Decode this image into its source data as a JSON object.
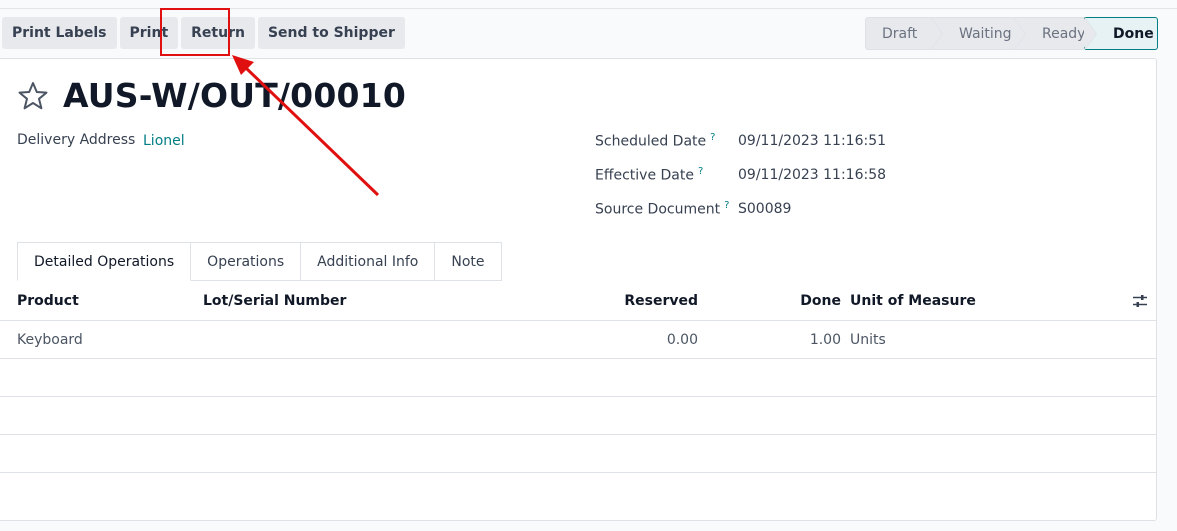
{
  "toolbar": {
    "print_labels": "Print Labels",
    "print": "Print",
    "return": "Return",
    "send_to_shipper": "Send to Shipper"
  },
  "statusbar": {
    "stages": [
      "Draft",
      "Waiting",
      "Ready",
      "Done"
    ],
    "active_stage": "Done"
  },
  "record": {
    "title": "AUS-W/OUT/00010",
    "delivery_address_label": "Delivery Address",
    "delivery_address_value": "Lionel",
    "scheduled_date_label": "Scheduled Date",
    "scheduled_date_value": "09/11/2023 11:16:51",
    "effective_date_label": "Effective Date",
    "effective_date_value": "09/11/2023 11:16:58",
    "source_document_label": "Source Document",
    "source_document_value": "S00089",
    "help_mark": "?"
  },
  "tabs": [
    "Detailed Operations",
    "Operations",
    "Additional Info",
    "Note"
  ],
  "table": {
    "columns": {
      "product": "Product",
      "lot": "Lot/Serial Number",
      "reserved": "Reserved",
      "done": "Done",
      "uom": "Unit of Measure"
    },
    "rows": [
      {
        "product": "Keyboard",
        "lot": "",
        "reserved": "0.00",
        "done": "1.00",
        "uom": "Units"
      }
    ]
  },
  "colors": {
    "accent": "#017e84",
    "annotation": "#e01010"
  },
  "icons": {
    "favorite": "star-icon",
    "column_settings": "sliders-icon"
  }
}
